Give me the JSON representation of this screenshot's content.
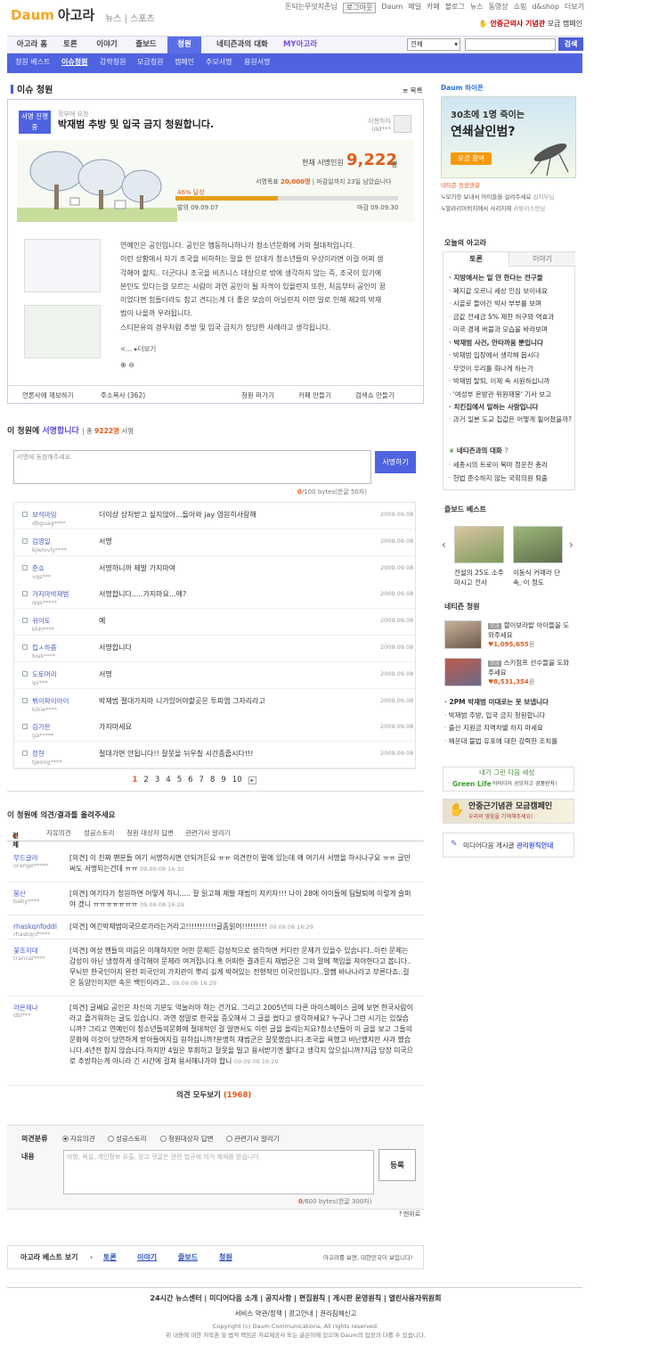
{
  "header": {
    "logo_daum": "Daum",
    "logo_title": "아고라",
    "links": "뉴스 | 스포츠",
    "user": "돈되는무엇지존님",
    "login": "로그아웃",
    "top_links": [
      "Daum",
      "메일",
      "카페",
      "블로그",
      "뉴스",
      "동영상",
      "쇼핑",
      "d&shop",
      "더보기"
    ],
    "campaign_pre": "안중근의사 기념관",
    "campaign_post": "모금 캠페인"
  },
  "nav1": {
    "tabs": [
      "아고라 홈",
      "토론",
      "이야기",
      "즐보드",
      "청원",
      "네티즌과의 대화",
      "MY아고라"
    ],
    "select": "전체",
    "search_btn": "검색"
  },
  "nav2": {
    "items": [
      "청원 베스트",
      "이슈청원",
      "감학청원",
      "모금청원",
      "캠페인",
      "추모서명",
      "용원서명"
    ]
  },
  "issue": {
    "title": "이슈 청원",
    "list_link": "목록",
    "badge": "서명 진행중",
    "subtitle": "정부에 요청",
    "petition_title": "박재범 추방 및 입국 금지 청원합니다.",
    "author_label": "이젠하자",
    "author_id": "idd***",
    "count_label": "현재 서명인원",
    "count": "9,222",
    "count_unit": "명",
    "goal_text_pre": "서명목표",
    "goal_value": "20,000명",
    "goal_text_post": "| 마감일까지 23일 남았습니다",
    "progress": 46,
    "progress_label": "46% 달성",
    "start": "발의 09.09.07",
    "end": "마감 09.09.30",
    "body": "연예인은 공인입니다. 공인은 행동하나하나가 청소년문화에 거의 절대적입니다.\n이런 상황에서 자기 조국을 비하하는 말을 한 상대가 청소년들의 우상이라면 이걸 어찌 생각해야 할지.. 더군다나 조국을 비즈니스 대상으로 밖에 생각하지 않는 즉, 조국이 있기에 본인도 있다는걸 모르는 사람이 과연 공인이 될 자격이 있을련지 또한, 처음부터 공인이 꿈이었다면 힘들더라도 참고 견디는게 더 좋은 모습이 아닐련지 이런 일로 인해 제2의 박재범이 나올까 우려됩니다.\n스티븐유의 경우처럼 추방 및 입국 금지가 정당한 사례라고 생각됩니다.",
    "more": "더보기",
    "ellipsis": "<...",
    "bottom_links": [
      "언론사에 제보하기",
      "주소복사 (362)",
      "청원 퍼가기",
      "카페 만들기",
      "검색쇼 만들기"
    ]
  },
  "sign": {
    "heading_pre": "이 청원에",
    "heading_em": "서명합니다",
    "total_pre": "총",
    "total": "9222명",
    "total_post": "서명",
    "placeholder": "서명에 동참해주세요.",
    "button": "서명하기",
    "counter_val": "0",
    "counter_rest": "/100 bytes(한글 50자)",
    "rows": [
      {
        "name": "보석마잉",
        "id": "dbguag****",
        "msg": "더이상 상처받고 싶지않아...돌아와 jay 영원히사랑해",
        "date": "2009.09.08"
      },
      {
        "name": "김영일",
        "id": "kjwlovly****",
        "msg": "서명",
        "date": "2009.09.08"
      },
      {
        "name": "준슈",
        "id": "vqs***",
        "msg": "서명하니까 제발 가지마여",
        "date": "2009.09.08"
      },
      {
        "name": "가지마박재범",
        "id": "qqs*****",
        "msg": "서명합니다.....가지마요...에?",
        "date": "2009.09.08"
      },
      {
        "name": "귀이도",
        "id": "khh****",
        "msg": "예",
        "date": "2009.09.08"
      },
      {
        "name": "킵ㅅ하줌",
        "id": "bisk****",
        "msg": "서명합니다",
        "date": "2009.09.08"
      },
      {
        "name": "도토머리",
        "id": "ipi***",
        "msg": "서명",
        "date": "2009.09.08"
      },
      {
        "name": "뷔이파이아이",
        "id": "kikie****",
        "msg": "박재범 절대가지마 니가있어야할곳은 투피엠 그자리라고",
        "date": "2009.09.08"
      },
      {
        "name": "김가은",
        "id": "ga*****",
        "msg": "가지마세요",
        "date": "2009.09.08"
      },
      {
        "name": "정현",
        "id": "tjeong****",
        "msg": "절대가면 안됩니다!! 잘못을 뉘우칠 시간좀줍시다!!!",
        "date": "2009.09.08"
      }
    ],
    "pages": [
      "1",
      "2",
      "3",
      "4",
      "5",
      "6",
      "7",
      "8",
      "9",
      "10"
    ]
  },
  "opinion": {
    "heading": "이 청원에 의견/결과를 올려주세요",
    "tabs": [
      "전체",
      "자유의견",
      "성공스토리",
      "청원 대상자 답변",
      "관련기사 알리기"
    ],
    "rows": [
      {
        "name": "무드글라",
        "id": "orange*****",
        "text": "[의견] 이 진짜 팬분들 여기 서명하시면 안되거든요 ㅠㅠ 의견란이 밑에 있는데 왜 여기서 서명을 하시나구요 ㅠㅠ 글만써도 서명되는건데 ㅠㅠ",
        "date": "09.09.08 16:30"
      },
      {
        "name": "붕산",
        "id": "baby****",
        "text": "[의견] 여기다가 청원하면 어떻게 하니..... 잘 읽고해 제발 재범이 지키자!!! 나이 28에 아이들에 팀탈퇴에 이렇게 슬퍼야 겠니 ㅠㅠㅠㅠㅠㅠㅠ",
        "date": "09.09.08 16:29"
      },
      {
        "name": "rhaskqnfoddl",
        "id": "rhaskqnf****",
        "text": "[의견] 여긴박재범미국으로가라는거라고!!!!!!!!!!!글좀읽어!!!!!!!!!",
        "date": "09.09.08 16:29"
      },
      {
        "name": "꽃조지대",
        "id": "trancal****",
        "text": "[의견] 여성 팬들의 마음은 이해하지만 어떤 문제든 감성적으로 생각하면 커다란 문제가 있을수 있습니다..이런 문제는 감성이 아닌 냉정하게 생각해야 문제라 여겨집니다.혹 어떠한 결과든지 재범군은 그의 말에 책임을 져야한다고 봅니다..무뇌만 한국인이지 완전 미국인의 가치관이 뿌리 깊게 박혀있는 전형적인 미국인입니다..말쨈 바나나라고 부른다죠..걸은 동양인이지만 속은 백인이라고..",
        "date": "09.09.08 16:29"
      },
      {
        "name": "라온제나",
        "id": "dbl***",
        "text": "[의견] 글쎄요 공인은 자신의 기분도 억눌러야 하는 건가요. 그리고 2005년의 다른 마이스페이스 글에 보면 한국사람이라고 즐거워하는 글도 있습니다. 과연 정말로 한국을 증오해서 그 글을 썼다고 생각하세요? 누구나 그런 시기는 있잖습니까? 그리고 연예인이 청소년들의문화에 절대적인 걸 알면서도 이런 글을 올리는지요?청소년들이 이 글을 보고 그들의 문화에 이것이 당연하게 받아들여지길 원하십니까?분명히 재범군은 잘못했습니다.조국을 욕했고 비난했지만 사과 했습니다.4년전 참지 않습니다.하지만 4일은 후회하고 잘못을 빌고 용서받기엔 짧다고 생각지 않으십니까?지금 당장 미국으로 추방하는게 아니라 긴 시간에 걸쳐 용서해나가야 합니",
        "date": "09.09.08 16:29"
      }
    ],
    "all_pre": "의견 모두보기",
    "all_count": "(1968)"
  },
  "form": {
    "label_cat": "의견분류",
    "label_body": "내용",
    "radios": [
      "자유의견",
      "성공스토리",
      "청원대상자 답변",
      "관련기사 알리기"
    ],
    "placeholder": "비방, 욕설, 개인정보 유출, 장고 댓글은 관련 법규에 의거 제재를 받습니다.",
    "button": "등록",
    "counter_val": "0",
    "counter_rest": "/600 bytes(한글 300자)",
    "top": "↑맨위로"
  },
  "best": {
    "label": "아고라 베스트 보기",
    "links": [
      "토론",
      "이야기",
      "즐보드",
      "청원"
    ],
    "slogan": "아고라를 보면, 대한민국이 보입니다!"
  },
  "sidebar": {
    "ad_title": "Daum 하이픈",
    "ad_line1": "30초에 1명 죽이는",
    "ad_line2": "연쇄살인범?",
    "ad_btn": "모금 참여",
    "ad_sub1": "네티즌 응원댓글",
    "ad_sub2": "↳모기장 보내서 아이들을 살려주세요",
    "ad_sub2b": "김치부님",
    "ad_sub3": "↳말라리아퇴치에서 사리지해",
    "ad_sub3b": "라밭리소연님",
    "today_title": "오늘의 아고라",
    "today_tabs": [
      "토론",
      "이야기"
    ],
    "today_items": [
      {
        "t": "지방에서는 일 안 한다는 전구들",
        "b": true
      },
      {
        "t": "폐지값 오르니 세상 인심 보이네요",
        "b": false
      },
      {
        "t": "시골로 들어간 박사 부부를 보며",
        "b": false
      },
      {
        "t": "금값 전세금 5% 제한 허구와 역효과",
        "b": false
      },
      {
        "t": "미국 경제 버블과 모습을 바라보며",
        "b": false
      },
      {
        "t": "박재범 사건, 안타까움 뿐입니다",
        "b": true
      },
      {
        "t": "박재범 입장에서 생각해 봅시다",
        "b": false
      },
      {
        "t": "무엇이 우리를 화나게 하는가",
        "b": false
      },
      {
        "t": "박재범 탈퇴, 이제 속 시원하십니까",
        "b": false
      },
      {
        "t": "'여성부 온방관 위원재봉' 기사 보고",
        "b": false
      },
      {
        "t": "치킨집에서 일하는 사람입니다",
        "b": true
      },
      {
        "t": "과거 일본 도교 집값은 어떻게 될어졌을까?",
        "b": false
      }
    ],
    "dialog_title": "네티즌과의 대화",
    "dialog_items": [
      "세종시의 트로이 목마 정운찬 총리",
      "헌법 준수하지 않는 국회의원 퇴출"
    ],
    "board_title": "즐보드 베스트",
    "board_items": [
      "전설의 25도 소주 마시고 전사",
      "이동식 커매라 단속, 이 정도"
    ],
    "net_title": "네티즌 청원",
    "net_items": [
      {
        "t": "캘이보라밭 아이들을 도와주세요",
        "v": "1,095,655"
      },
      {
        "t": "스키점프 선수들을 도와주세요",
        "v": "8,531,354"
      }
    ],
    "net_list": [
      "2PM 박재범 미대로는 못 보냅니다",
      "박재범 추방, 입국 금지 청원합니다",
      "출산 지원금 지역차별 하지 마세요",
      "해운대 불법 유포에 대한 강력한 조치를"
    ],
    "won": "원",
    "banner1": "내가 그린 다음 세상",
    "banner1b": "Green Life",
    "banner1c": "아이디어 공모하고 경품받자!",
    "banner2": "안중근기념관 모금캠페인",
    "banner2b": "우리의 영웅을 기억해주세요!",
    "banner3_pre": "미디어다음 게시글",
    "banner3_em": "관리원칙안내"
  },
  "footer": {
    "links1": "24시간 뉴스센터 | 미디어다음 소개 | 공지사항 | 편집원칙 | 게시판 운영원칙 | 열린사용자위원회",
    "links2": "서비스 약관/정책 | 광고안내 | 권리침해신고",
    "copy": "Copyright (c) Daum Communications, All rights reserved.",
    "note": "위 내용에 대한 저작권 및 법적 책임은 자료제공사 또는 글쓴이에 있으며 Daum의 입장과 다를 수 있습니다."
  }
}
